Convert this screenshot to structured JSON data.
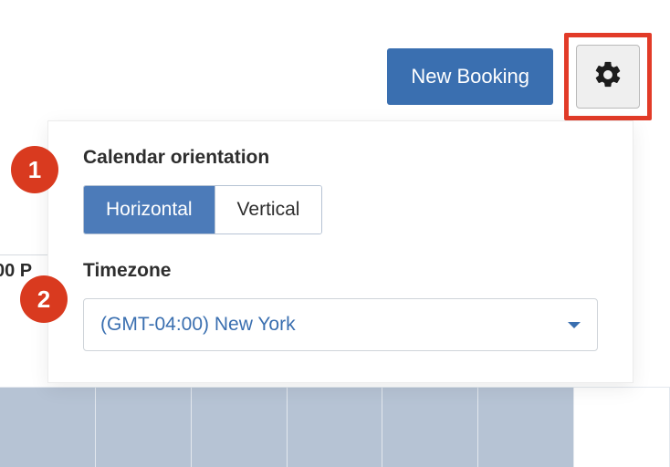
{
  "topbar": {
    "new_booking_label": "New Booking"
  },
  "popover": {
    "orientation_label": "Calendar orientation",
    "orientation_options": {
      "horizontal": "Horizontal",
      "vertical": "Vertical"
    },
    "timezone_label": "Timezone",
    "timezone_value": "(GMT-04:00) New York"
  },
  "callouts": {
    "one": "1",
    "two": "2"
  },
  "background": {
    "hour_fragment": "00 P"
  }
}
